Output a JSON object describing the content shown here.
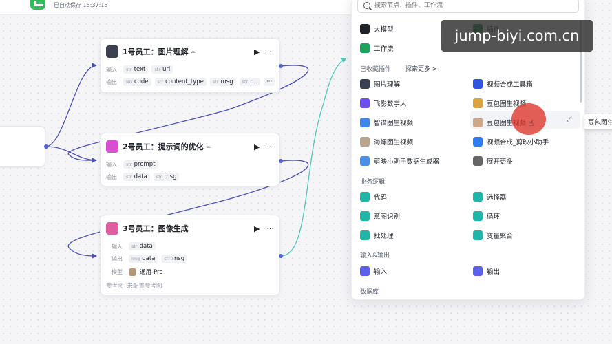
{
  "topbar": {
    "autosave": "已自动保存 15:37:15"
  },
  "nodes": [
    {
      "title": "1号员工：图片理解",
      "input_label": "输入",
      "inputs": [
        {
          "type": "str",
          "name": "text"
        },
        {
          "type": "str",
          "name": "url"
        }
      ],
      "output_label": "输出",
      "outputs": [
        {
          "type": "N0",
          "name": "code"
        },
        {
          "type": "str",
          "name": "content_type"
        },
        {
          "type": "str",
          "name": "msg"
        },
        {
          "type": "str",
          "name": "r..."
        }
      ],
      "more": "···"
    },
    {
      "title": "2号员工：提示词的优化",
      "input_label": "输入",
      "inputs": [
        {
          "type": "str",
          "name": "prompt"
        }
      ],
      "output_label": "输出",
      "outputs": [
        {
          "type": "str",
          "name": "data"
        },
        {
          "type": "str",
          "name": "msg"
        }
      ]
    },
    {
      "title": "3号员工：图像生成",
      "input_label": "输入",
      "inputs": [
        {
          "type": "str",
          "name": "data"
        }
      ],
      "output_label": "输出",
      "outputs": [
        {
          "type": "img",
          "name": "data"
        },
        {
          "type": "str",
          "name": "msg"
        }
      ],
      "model_label": "模型",
      "model_value": "通用-Pro",
      "ref_label": "参考图",
      "ref_value": "未配置参考图"
    }
  ],
  "node_actions": {
    "run": "▶",
    "menu": "···",
    "tag": "⌓"
  },
  "panel": {
    "search_placeholder": "搜索节点、插件、工作流",
    "top_items": [
      {
        "label": "大模型",
        "icon": "model-icon"
      },
      {
        "label": "插件",
        "icon": "plugin-icon"
      },
      {
        "label": "工作流",
        "icon": "workflow-icon"
      }
    ],
    "favorites_title": "已收藏插件",
    "explore_more": "探索更多 >",
    "favorites": [
      {
        "label": "图片理解",
        "icon": "image-understanding-icon",
        "color": "#3b4150"
      },
      {
        "label": "视频合成工具箱",
        "icon": "video-toolbox-icon",
        "color": "#2f55e0"
      },
      {
        "label": "飞影数字人",
        "icon": "digital-human-icon",
        "color": "#6d4df0"
      },
      {
        "label": "豆包图生视频",
        "icon": "doubao-video-icon",
        "color": "#d9a441"
      },
      {
        "label": "智谱图生视频",
        "icon": "zhipu-video-icon",
        "color": "#3f87e6"
      },
      {
        "label": "豆包图生视频",
        "icon": "doubao-avatar-icon",
        "color": "#c9a98a"
      },
      {
        "label": "海螺图生视频",
        "icon": "hailuo-video-icon",
        "color": "#b9a58f"
      },
      {
        "label": "视频合成_剪映小助手",
        "icon": "jianying-assistant-icon",
        "color": "#2f7cf0"
      },
      {
        "label": "剪映小助手数据生成器",
        "icon": "jianying-data-icon",
        "color": "#4a8ee8"
      },
      {
        "label": "展开更多",
        "icon": "chevron-down-icon",
        "color": "#666666"
      }
    ],
    "logic_title": "业务逻辑",
    "logic": [
      {
        "label": "代码",
        "icon": "code-icon",
        "color": "#1fb5a7"
      },
      {
        "label": "选择器",
        "icon": "selector-icon",
        "color": "#1fb5a7"
      },
      {
        "label": "意图识别",
        "icon": "intent-icon",
        "color": "#1fb5a7"
      },
      {
        "label": "循环",
        "icon": "loop-icon",
        "color": "#1fb5a7"
      },
      {
        "label": "批处理",
        "icon": "batch-icon",
        "color": "#1fb5a7"
      },
      {
        "label": "变量聚合",
        "icon": "aggregate-icon",
        "color": "#1fb5a7"
      }
    ],
    "io_title": "输入&输出",
    "io": [
      {
        "label": "输入",
        "icon": "input-icon",
        "color": "#5b61e8"
      },
      {
        "label": "输出",
        "icon": "output-icon",
        "color": "#5b61e8"
      }
    ],
    "db_title": "数据库"
  },
  "tooltip": "豆包图生",
  "watermark": "jump-biyi.com.cn"
}
